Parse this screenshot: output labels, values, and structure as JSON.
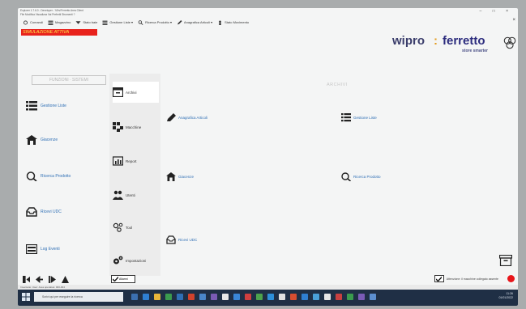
{
  "window": {
    "title": "Explorer 1.7.6.0 - Developer - \\\\Srv\\Ferretto Area Client",
    "menu": "File  Modifica  Visualizza  Vai  Preferiti  Strumenti  ?",
    "controls": "–  □  ×"
  },
  "toolbar": {
    "items": [
      {
        "label": "Comandi",
        "icon": "wrench-icon"
      },
      {
        "label": "Magazzino",
        "icon": "list-icon"
      },
      {
        "label": "Stato baie",
        "icon": "monitor-icon"
      },
      {
        "label": "Gestione Liste ▾",
        "icon": "list-icon"
      },
      {
        "label": "Ricerca Prodotto ▾",
        "icon": "search-icon"
      },
      {
        "label": "Anagrafica Articoli ▾",
        "icon": "pencil-icon"
      },
      {
        "label": "Stato Movimento",
        "icon": "person-icon"
      }
    ],
    "close": "×"
  },
  "simulation_badge": "SIMULAZIONE ATTIVA",
  "brand": {
    "wipro": "wipro",
    "colon": ":",
    "ferretto": "ferretto",
    "tagline": "store smarter"
  },
  "functions_label": "FUNZIONI · SISTEMI",
  "archivi_label": "ARCHIVI",
  "sidebar": [
    {
      "label": "Gestione Liste",
      "icon": "list-icon"
    },
    {
      "label": "Giacenze",
      "icon": "warehouse-icon"
    },
    {
      "label": "Ricerca Prodotto",
      "icon": "search-icon"
    },
    {
      "label": "Ricevi UDC",
      "icon": "tray-icon"
    },
    {
      "label": "Log Eventi",
      "icon": "log-icon"
    }
  ],
  "middle": [
    {
      "label": "Archivi",
      "icon": "archive-icon",
      "active": true
    },
    {
      "label": "Macchine",
      "icon": "machine-icon",
      "active": false
    },
    {
      "label": "Report",
      "icon": "report-icon",
      "active": false
    },
    {
      "label": "Utenti",
      "icon": "users-icon",
      "active": false
    },
    {
      "label": "Tool",
      "icon": "tools-icon",
      "active": false
    },
    {
      "label": "Impostazioni",
      "icon": "gears-icon",
      "active": false
    }
  ],
  "center": {
    "anagrafica": "Anagrafica Articoli",
    "gestione_liste": "Gestione Liste",
    "giacenze": "Giacenze",
    "ricerca_prodotto": "Ricerca Prodotto",
    "ricevi_udc": "Ricevi UDC"
  },
  "bottom": {
    "ack_label": "Allarmi",
    "status_text": "Attenzione: il macchine collegato assente",
    "status_strip": "Inventario: User: Area operativa: 000-004"
  },
  "taskbar": {
    "search_placeholder": "Scrivi qui per eseguire la ricerca",
    "time": "11:26",
    "date": "01/01/2022"
  },
  "colors": {
    "badge_bg": "#e8221c",
    "badge_text": "#ffe84b",
    "link": "#2f6fb5",
    "taskbar": "#1f2f45"
  }
}
